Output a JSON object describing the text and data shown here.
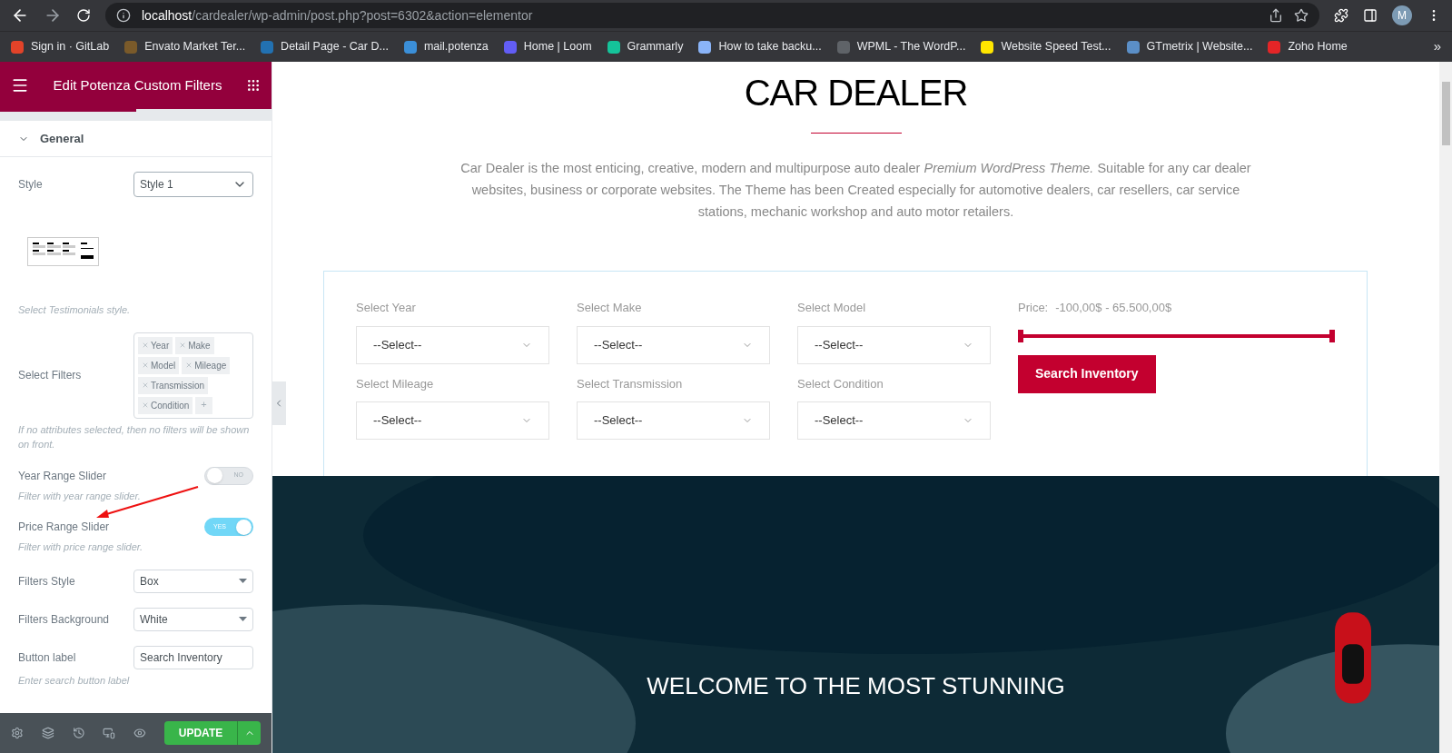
{
  "browser": {
    "url_host": "localhost",
    "url_path": "/cardealer/wp-admin/post.php?post=6302&action=elementor",
    "avatar": "M",
    "bookmarks": [
      {
        "label": "Sign in · GitLab",
        "color": "#e24329"
      },
      {
        "label": "Envato Market Ter...",
        "color": "#7a5a2a"
      },
      {
        "label": "Detail Page - Car D...",
        "color": "#2271b1"
      },
      {
        "label": "mail.potenza",
        "color": "#3b8fd8"
      },
      {
        "label": "Home | Loom",
        "color": "#625df5"
      },
      {
        "label": "Grammarly",
        "color": "#15c39a"
      },
      {
        "label": "How to take backu...",
        "color": "#8ab4f8"
      },
      {
        "label": "WPML - The WordP...",
        "color": "#5f6368"
      },
      {
        "label": "Website Speed Test...",
        "color": "#ffe600"
      },
      {
        "label": "GTmetrix | Website...",
        "color": "#5b8fc7"
      },
      {
        "label": "Zoho Home",
        "color": "#e42527"
      }
    ],
    "more": "»"
  },
  "panel": {
    "title": "Edit Potenza Custom Filters",
    "section": {
      "label": "General",
      "expanded": true
    },
    "style": {
      "label": "Style",
      "value": "Style 1",
      "hint": "Select Testimonials style."
    },
    "filters": {
      "label": "Select Filters",
      "tags": [
        "Year",
        "Make",
        "Model",
        "Mileage",
        "Transmission",
        "Condition"
      ],
      "add": "+",
      "hint": "If no attributes selected, then no filters will be shown on front."
    },
    "switches": [
      {
        "label": "Year Range Slider",
        "on": false,
        "text": "NO",
        "hint": "Filter with year range slider."
      },
      {
        "label": "Price Range Slider",
        "on": true,
        "text": "YES",
        "hint": "Filter with price range slider."
      }
    ],
    "selects": [
      {
        "label": "Filters Style",
        "value": "Box"
      },
      {
        "label": "Filters Background",
        "value": "White"
      }
    ],
    "button_label": {
      "label": "Button label",
      "value": "Search Inventory",
      "hint": "Enter search button label"
    },
    "update": "UPDATE"
  },
  "page": {
    "title": "CAR DEALER",
    "intro": "Car Dealer is the most enticing, creative, modern and multipurpose auto dealer *Premium WordPress Theme.* Suitable for any car dealer websites, business or corporate websites. The Theme has been Created especially for automotive dealers, car resellers, car service stations, mechanic workshop and auto motor retailers.",
    "filters": [
      {
        "label": "Select Year",
        "value": "--Select--"
      },
      {
        "label": "Select Make",
        "value": "--Select--"
      },
      {
        "label": "Select Model",
        "value": "--Select--"
      },
      {
        "label": "Select Mileage",
        "value": "--Select--"
      },
      {
        "label": "Select Transmission",
        "value": "--Select--"
      },
      {
        "label": "Select Condition",
        "value": "--Select--"
      }
    ],
    "price_label": "Price:",
    "price_range": "-100,00$ - 65.500,00$",
    "range": {
      "level": 1
    },
    "search": "Search Inventory",
    "hero": {
      "kind": "picture",
      "heading": "WELCOME TO THE MOST STUNNING"
    }
  }
}
